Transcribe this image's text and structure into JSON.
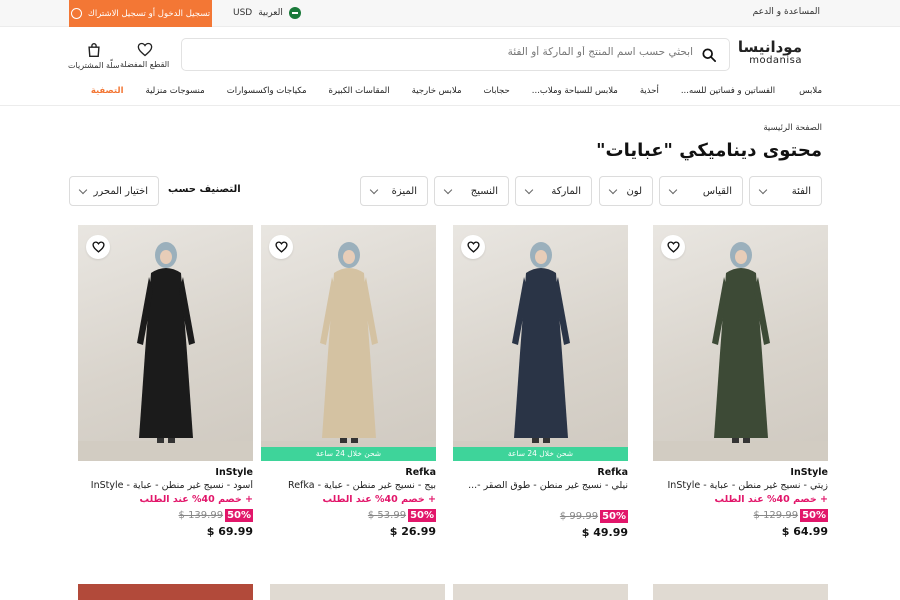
{
  "topbar": {
    "help": "المساعدة و الدعم",
    "language": "العربية",
    "currency": "USD",
    "login": "تسجيل الدخول أو تسجيل الاشتراك",
    "colors": {
      "accent": "#f37735",
      "topbar_bg": "#f7f7f7"
    }
  },
  "header": {
    "logo_ar": "مودانيسا",
    "logo_en": "modanisa",
    "search_placeholder": "ابحثي حسب اسم المنتج أو الماركة أو الفئة",
    "favorites_label": "القطع المفضلة",
    "cart_label": "سلّة المشتريات"
  },
  "nav": {
    "items": [
      {
        "label": "ملابس"
      },
      {
        "label": "الفساتين و فساتين للسه..."
      },
      {
        "label": "أحذية"
      },
      {
        "label": "ملابس للسباحة وملاب..."
      },
      {
        "label": "حجابات"
      },
      {
        "label": "ملابس خارجية"
      },
      {
        "label": "المقاسات الكبيرة"
      },
      {
        "label": "مكياجات واكسسوارات"
      },
      {
        "label": "منسوجات منزلية"
      },
      {
        "label": "التصفية"
      }
    ]
  },
  "breadcrumb": "الصفحة الرئيسية",
  "page_title": "محتوى ديناميكي \"عبايات\"",
  "filters": {
    "category": "الفئة",
    "size": "القياس",
    "color": "لون",
    "brand": "الماركة",
    "fabric": "النسيج",
    "feature": "الميزة",
    "sort_label": "التصنيف حسب",
    "sort_value": "اختيار المحرر"
  },
  "products": [
    {
      "brand": "InStyle",
      "name": "زيتي - نسيج غير منطن - عباية - InStyle",
      "promo": "+ خصم 40% عند الطلب",
      "old_price": "129.99 $",
      "discount": "50%",
      "new_price": "64.99 $",
      "shipping": "",
      "color": "#3d4a36"
    },
    {
      "brand": "Refka",
      "name": "نيلي - نسيج غير منطن - طوق الصقر -...",
      "promo": "",
      "old_price": "99.99 $",
      "discount": "50%",
      "new_price": "49.99 $",
      "shipping": "شحن خلال 24 ساعة",
      "color": "#2a3446"
    },
    {
      "brand": "Refka",
      "name": "بيج - نسيج غير منطن - عباية - Refka",
      "promo": "+ خصم 40% عند الطلب",
      "old_price": "53.99 $",
      "discount": "50%",
      "new_price": "26.99 $",
      "shipping": "شحن خلال 24 ساعة",
      "color": "#d4c2a2"
    },
    {
      "brand": "InStyle",
      "name": "أسود - نسيج غير منطن - عباية - InStyle",
      "promo": "+ خصم 40% عند الطلب",
      "old_price": "139.99 $",
      "discount": "50%",
      "new_price": "69.99 $",
      "shipping": "",
      "color": "#1b1b1b"
    }
  ]
}
